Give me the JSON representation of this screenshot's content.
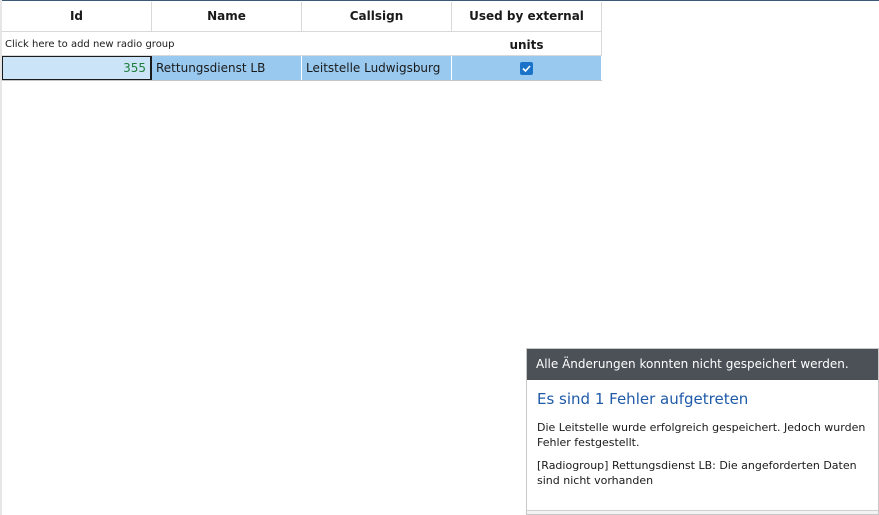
{
  "grid": {
    "columns": [
      "Id",
      "Name",
      "Callsign",
      "Used by external units"
    ],
    "add_row_label": "Click here to add new radio group",
    "rows": [
      {
        "id": "355",
        "name": "Rettungsdienst LB",
        "callsign": "Leitstelle Ludwigsburg",
        "used_by_external": true
      }
    ]
  },
  "notification": {
    "header": "Alle Änderungen konnten nicht gespeichert werden.",
    "title": "Es sind 1 Fehler aufgetreten",
    "message": "Die Leitstelle wurde erfolgreich gespeichert. Jedoch wurden Fehler festgestellt.",
    "error": "[Radiogroup] Rettungsdienst LB: Die angeforderten Daten sind nicht vorhanden"
  },
  "colors": {
    "selected_row": "#99c9ef",
    "header_bar": "#4b5157",
    "title_blue": "#1f5aa8",
    "id_green": "#1e7f3a"
  },
  "icons": {
    "checkbox": "checkmark-icon"
  }
}
